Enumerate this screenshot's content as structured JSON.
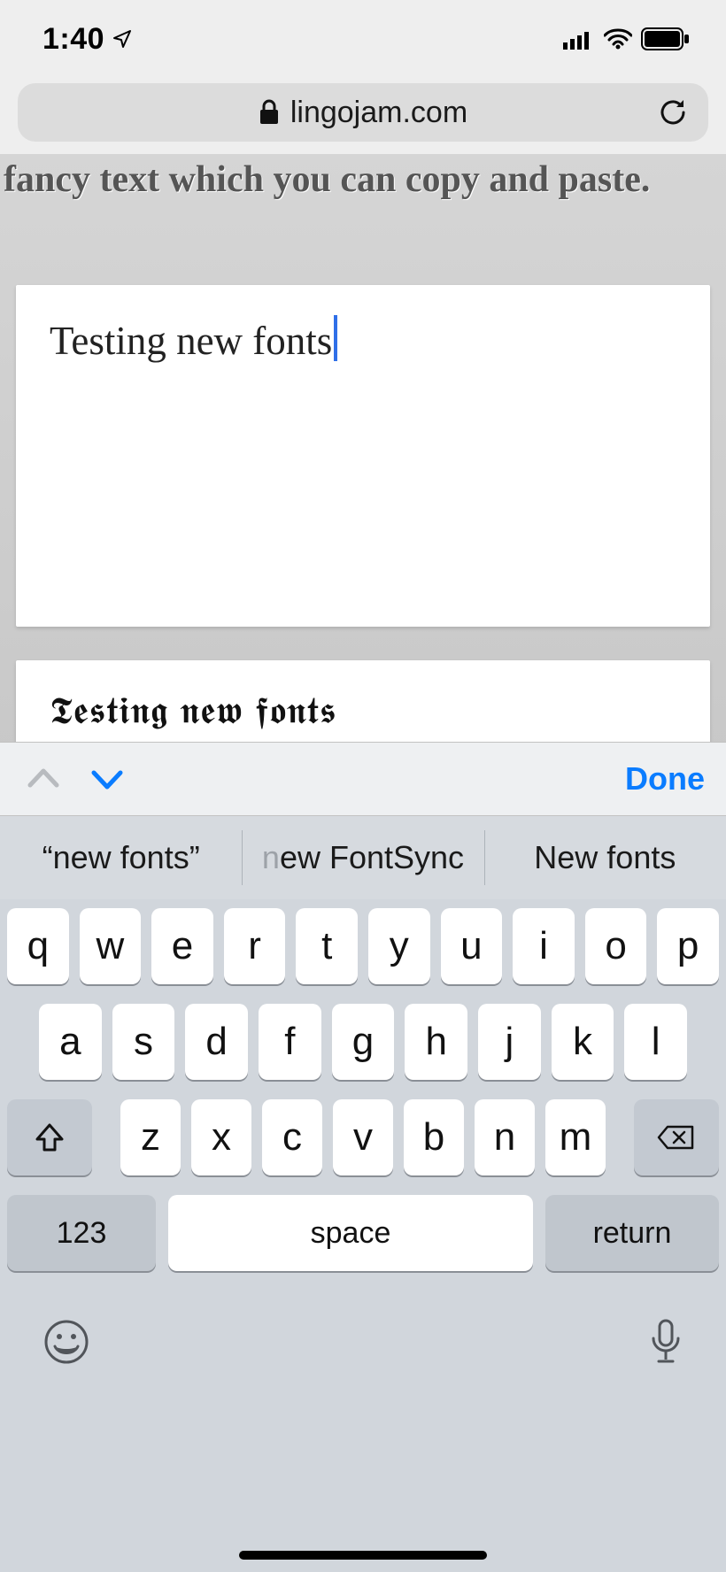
{
  "status": {
    "time": "1:40"
  },
  "browser": {
    "domain": "lingojam.com"
  },
  "page": {
    "heading": "fancy text which you can copy and paste.",
    "input_text": "Testing new fonts",
    "output_text": "𝕿𝖊𝖘𝖙𝖎𝖓𝖌 𝖓𝖊𝖜 𝖋𝖔𝖓𝖙𝖘"
  },
  "accessory": {
    "done": "Done"
  },
  "suggestions": {
    "s1": "“new fonts”",
    "s2_pre": "n",
    "s2_rest": "ew FontSync",
    "s3": "New fonts"
  },
  "keyboard": {
    "row1": [
      "q",
      "w",
      "e",
      "r",
      "t",
      "y",
      "u",
      "i",
      "o",
      "p"
    ],
    "row2": [
      "a",
      "s",
      "d",
      "f",
      "g",
      "h",
      "j",
      "k",
      "l"
    ],
    "row3": [
      "z",
      "x",
      "c",
      "v",
      "b",
      "n",
      "m"
    ],
    "k123": "123",
    "space": "space",
    "return": "return"
  }
}
